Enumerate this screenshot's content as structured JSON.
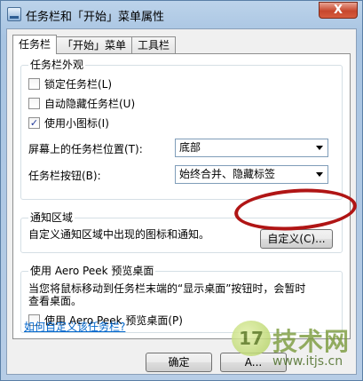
{
  "window": {
    "title": "任务栏和「开始」菜单属性",
    "close_glyph": "X"
  },
  "tabs": [
    {
      "label": "任务栏",
      "active": true
    },
    {
      "label": "「开始」菜单",
      "active": false
    },
    {
      "label": "工具栏",
      "active": false
    }
  ],
  "appearance": {
    "title": "任务栏外观",
    "lock": {
      "label": "锁定任务栏(L)",
      "checked": false,
      "mark": ""
    },
    "autohide": {
      "label": "自动隐藏任务栏(U)",
      "checked": false,
      "mark": ""
    },
    "small_icons": {
      "label": "使用小图标(I)",
      "checked": true,
      "mark": "✓"
    },
    "position": {
      "label": "屏幕上的任务栏位置(T):",
      "value": "底部"
    },
    "buttons": {
      "label": "任务栏按钮(B):",
      "value": "始终合并、隐藏标签"
    }
  },
  "notification": {
    "title": "通知区域",
    "description": "自定义通知区域中出现的图标和通知。",
    "customize_button": "自定义(C)..."
  },
  "aero_peek": {
    "title": "使用 Aero Peek 预览桌面",
    "description_line1": "当您将鼠标移动到任务栏末端的“显示桌面”按钮时，会暂时",
    "description_line2": "查看桌面。",
    "checkbox": {
      "label": "使用 Aero Peek 预览桌面(P)",
      "checked": false,
      "mark": ""
    }
  },
  "help_link": "如何自定义该任务栏?",
  "footer": {
    "ok_label": "确定",
    "apply_label": "A..."
  },
  "watermark": {
    "logo": "17",
    "name": "技术网",
    "url": "www.itjs.cn"
  },
  "colors": {
    "link": "#0066cc",
    "highlight_ellipse": "#b01515",
    "close_button": "#c7472d"
  }
}
